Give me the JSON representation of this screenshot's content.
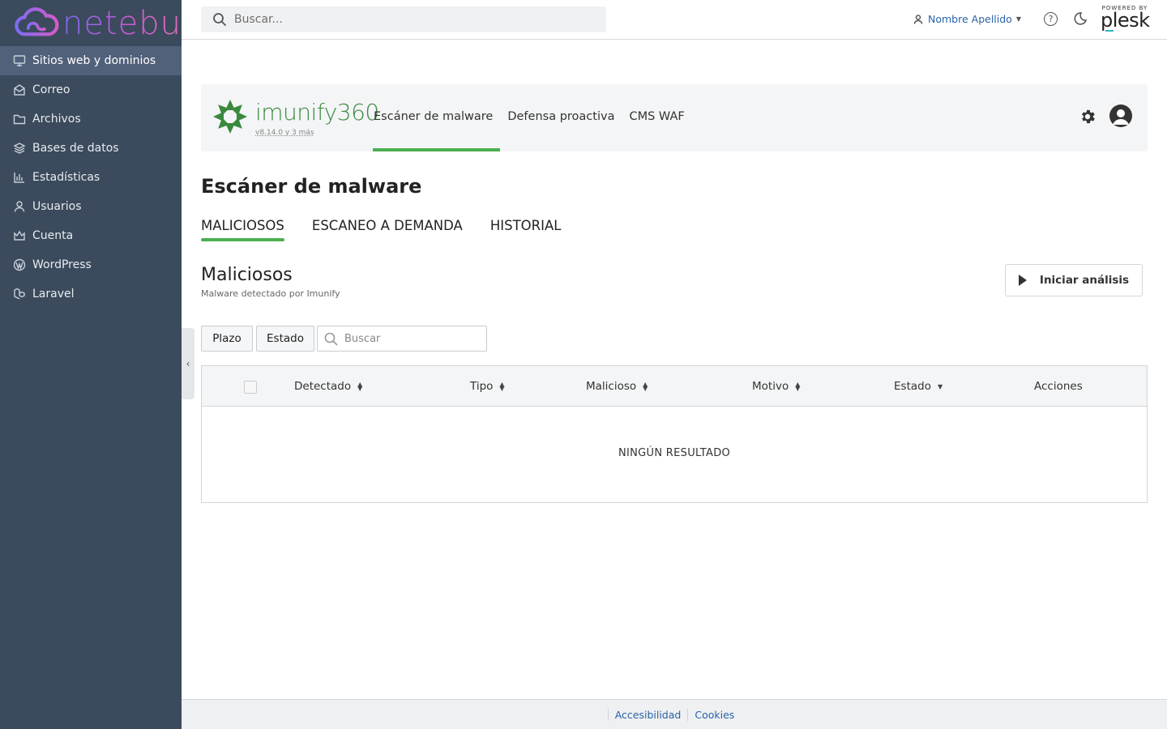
{
  "brand": {
    "name": "netebu"
  },
  "sidebar": {
    "items": [
      {
        "label": "Sitios web y dominios",
        "icon": "monitor-icon",
        "active": true
      },
      {
        "label": "Correo",
        "icon": "mail-icon"
      },
      {
        "label": "Archivos",
        "icon": "folder-icon"
      },
      {
        "label": "Bases de datos",
        "icon": "database-layers-icon"
      },
      {
        "label": "Estadísticas",
        "icon": "bar-chart-icon"
      },
      {
        "label": "Usuarios",
        "icon": "user-icon"
      },
      {
        "label": "Cuenta",
        "icon": "crown-icon"
      },
      {
        "label": "WordPress",
        "icon": "wordpress-icon"
      },
      {
        "label": "Laravel",
        "icon": "laravel-icon"
      }
    ]
  },
  "topbar": {
    "search_placeholder": "Buscar...",
    "user_name": "Nombre Apellido",
    "help_glyph": "?",
    "powered_small": "POWERED BY",
    "powered_brand": "plesk"
  },
  "imunify": {
    "brand": "imunify360",
    "version": "v8.14.0 y 3 más",
    "tabs": [
      "Escáner de malware",
      "Defensa proactiva",
      "CMS WAF"
    ],
    "active_tab": 0,
    "accent_color": "#4caf50"
  },
  "page": {
    "title": "Escáner de malware",
    "subtabs": [
      "MALICIOSOS",
      "ESCANEO A DEMANDA",
      "HISTORIAL"
    ],
    "section_title": "Maliciosos",
    "section_subtitle": "Malware detectado por Imunify",
    "start_button": "Iniciar análisis"
  },
  "filters": {
    "plazo": "Plazo",
    "estado": "Estado",
    "search_placeholder": "Buscar"
  },
  "table": {
    "columns": [
      "Detectado",
      "Tipo",
      "Malicioso",
      "Motivo",
      "Estado",
      "Acciones"
    ],
    "empty_text": "NINGÚN RESULTADO"
  },
  "footer": {
    "links": [
      "Accesibilidad",
      "Cookies"
    ]
  }
}
